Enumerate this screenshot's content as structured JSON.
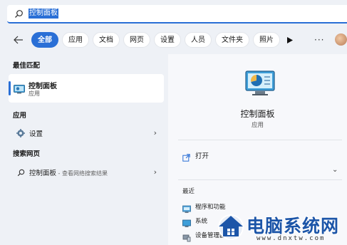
{
  "search": {
    "query": "控制面板"
  },
  "filters": {
    "back_icon": "arrow-left-icon",
    "chips": [
      "全部",
      "应用",
      "文档",
      "网页",
      "设置",
      "人员",
      "文件夹",
      "照片"
    ],
    "play_icon": "play-icon",
    "more_label": "···"
  },
  "left": {
    "best_match_title": "最佳匹配",
    "best_match": {
      "title": "控制面板",
      "subtitle": "应用"
    },
    "apps_title": "应用",
    "apps_item": {
      "label": "设置"
    },
    "web_title": "搜索网页",
    "web_item": {
      "label": "控制面板",
      "suffix": " - 查看网络搜索结果"
    }
  },
  "detail": {
    "title": "控制面板",
    "subtitle": "应用",
    "open_label": "打开",
    "recent_title": "最近",
    "recent": [
      "程序和功能",
      "系统",
      "设备管理器"
    ]
  },
  "watermark": {
    "text": "电脑系统网",
    "url": "www.dnxtw.com"
  },
  "colors": {
    "accent": "#2a6fd6",
    "watermark": "#1c55a8"
  }
}
